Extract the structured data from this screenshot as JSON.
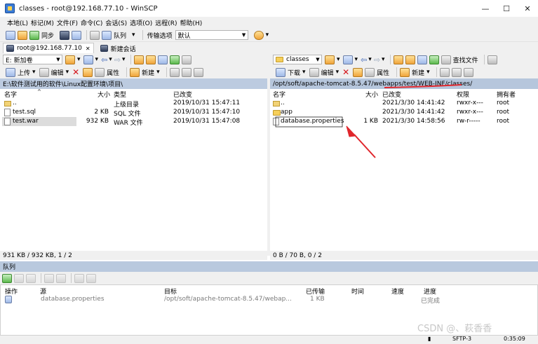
{
  "window": {
    "title": "classes - root@192.168.77.10 - WinSCP",
    "minimize": "—",
    "maximize": "☐",
    "close": "✕"
  },
  "menu": [
    "本地(L)",
    "标记(M)",
    "文件(F)",
    "命令(C)",
    "会话(S)",
    "选项(O)",
    "远程(R)",
    "帮助(H)"
  ],
  "toolbar": {
    "sync": "同步",
    "queue": "队列",
    "transfer_options": "传输选项",
    "transfer_preset": "默认"
  },
  "tabs": {
    "session": "root@192.168.77.10",
    "new_session": "新建会话"
  },
  "left": {
    "drive": "E: 新加卷",
    "upload": "上传",
    "edit": "编辑",
    "properties": "属性",
    "new": "新建",
    "path": "E:\\软件测试用的软件\\Linux配置环境\\项目\\",
    "columns": {
      "name": "名字",
      "size": "大小",
      "type": "类型",
      "changed": "已改变"
    },
    "files": [
      {
        "name": "..",
        "size": "",
        "type": "上级目录",
        "changed": "2019/10/31  15:47:11",
        "icon": "parent-dir-icon"
      },
      {
        "name": "test.sql",
        "size": "2 KB",
        "type": "SQL 文件",
        "changed": "2019/10/31  15:47:10",
        "icon": "file-icon"
      },
      {
        "name": "test.war",
        "size": "932 KB",
        "type": "WAR 文件",
        "changed": "2019/10/31  15:47:08",
        "icon": "file-icon"
      }
    ],
    "status": "931 KB / 932 KB,  1 / 2"
  },
  "right": {
    "dir": "classes",
    "download": "下载",
    "edit": "编辑",
    "properties": "属性",
    "new": "新建",
    "find": "查找文件",
    "path": "/opt/soft/apache-tomcat-8.5.47/webapps/test/WEB-INF/classes/",
    "columns": {
      "name": "名字",
      "size": "大小",
      "changed": "已改变",
      "perms": "权限",
      "owner": "拥有者"
    },
    "files": [
      {
        "name": "..",
        "size": "",
        "changed": "2021/3/30  14:41:42",
        "perms": "rwxr-x---",
        "owner": "root",
        "icon": "parent-dir-icon"
      },
      {
        "name": "app",
        "size": "",
        "changed": "2021/3/30  14:41:42",
        "perms": "rwxr-x---",
        "owner": "root",
        "icon": "folder-icon"
      },
      {
        "name": "database.properties",
        "size": "1 KB",
        "changed": "2021/3/30  14:58:56",
        "perms": "rw-r-----",
        "owner": "root",
        "icon": "file-icon"
      }
    ],
    "status": "0 B / 70 B,  0 / 2"
  },
  "queue": {
    "title": "队列",
    "columns": {
      "op": "操作",
      "source": "源",
      "target": "目标",
      "transferred": "已传输",
      "time": "时间",
      "speed": "速度",
      "progress": "进度"
    },
    "rows": [
      {
        "source": "database.properties",
        "target": "/opt/soft/apache-tomcat-8.5.47/webap...",
        "transferred": "1 KB",
        "time": "",
        "speed": "",
        "progress": "已完成"
      }
    ]
  },
  "bottom": {
    "protocol": "SFTP-3",
    "elapsed": "0:35:09",
    "watermark": "CSDN @、萩香香"
  },
  "colors": {
    "annotation_red": "#e0262c",
    "path_bar": "#bccbe0"
  }
}
